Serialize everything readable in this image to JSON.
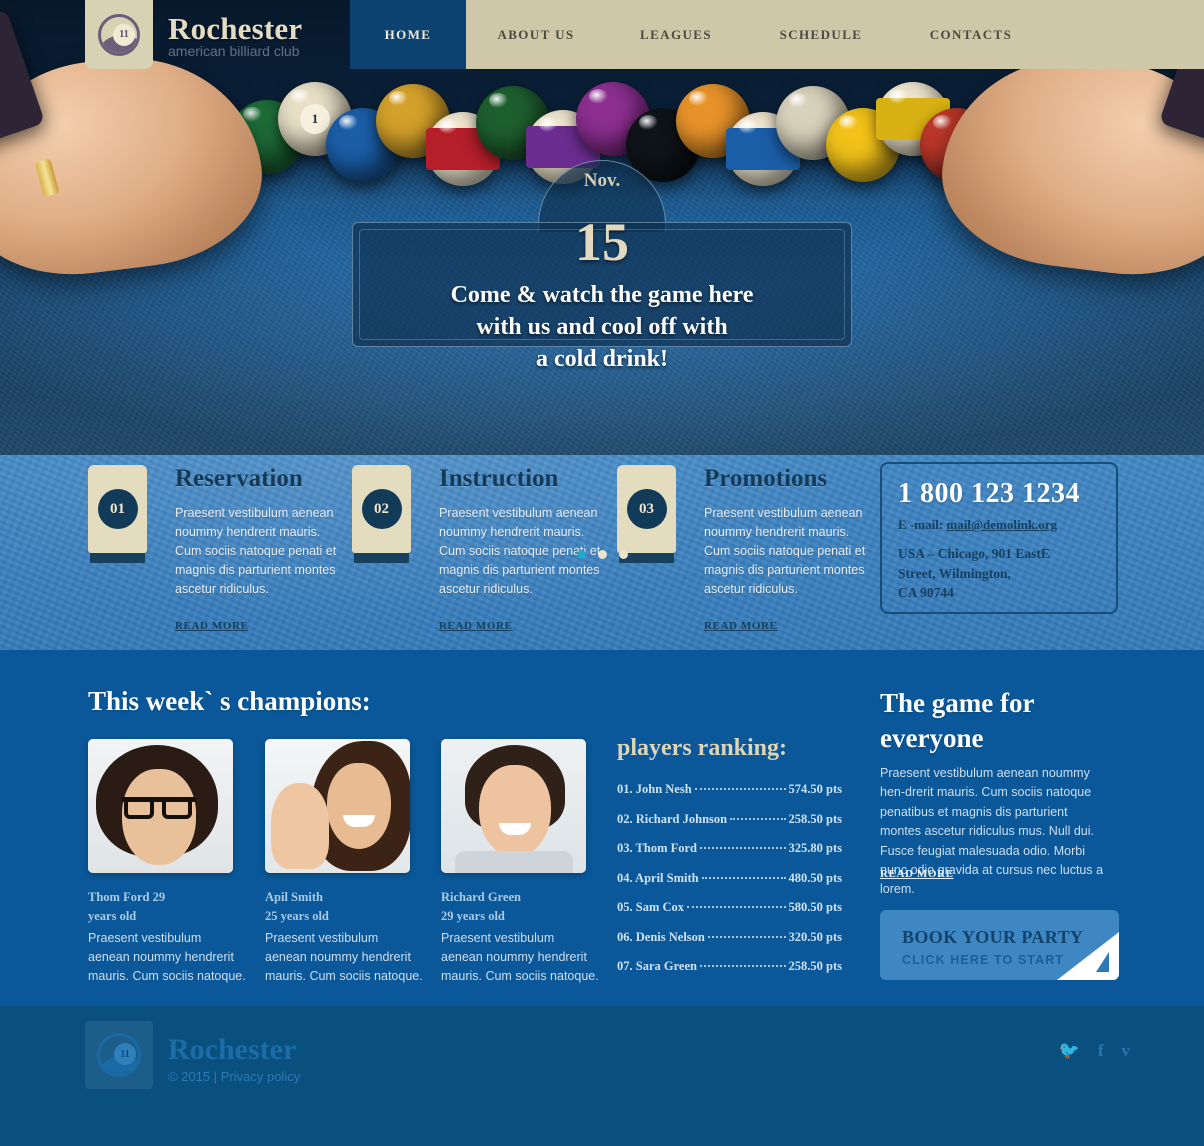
{
  "header": {
    "brand_name": "Rochester",
    "brand_tagline": "american billiard club",
    "logo_icon": "billiard-ball-icon",
    "logo_number": "11",
    "nav": [
      {
        "label": "HOME",
        "active": true
      },
      {
        "label": "ABOUT US",
        "active": false
      },
      {
        "label": "LEAGUES",
        "active": false
      },
      {
        "label": "SCHEDULE",
        "active": false
      },
      {
        "label": "CONTACTS",
        "active": false
      }
    ]
  },
  "hero": {
    "month": "Nov.",
    "day": "15",
    "line1": "Come & watch the game here",
    "line2": "with us and cool off with",
    "line3": "a cold drink!",
    "slider_dots": 3,
    "active_dot": 1,
    "active_dot_color": "#22a6c9",
    "inactive_dot_color": "#ece3c8"
  },
  "features": [
    {
      "number": "01",
      "title": "Reservation",
      "text": "Praesent vestibulum aenean noummy hendrerit mauris. Cum sociis natoque penati et magnis dis parturient montes ascetur ridiculus.",
      "read_more": "READ MORE"
    },
    {
      "number": "02",
      "title": "Instruction",
      "text": "Praesent vestibulum aenean noummy hendrerit mauris. Cum sociis natoque penati et magnis dis parturient montes ascetur ridiculus.",
      "read_more": "READ MORE"
    },
    {
      "number": "03",
      "title": "Promotions",
      "text": "Praesent vestibulum aenean noummy hendrerit mauris. Cum sociis natoque penati et magnis dis parturient montes ascetur ridiculus.",
      "read_more": "READ MORE"
    }
  ],
  "contact": {
    "phone": "1 800 123 1234",
    "email_label": "E -mail:",
    "email": "mail@demolink.org",
    "address_line1": "USA – Chicago, 901 EastE",
    "address_line2": "Street, Wilmington,",
    "address_line3": "CA 90744"
  },
  "champions": {
    "heading": "This week` s champions:",
    "people": [
      {
        "name_line1": "Thom Ford 29",
        "name_line2": "years old",
        "desc": "Praesent vestibulum aenean noummy hendrerit mauris. Cum sociis natoque."
      },
      {
        "name_line1": "Apil Smith",
        "name_line2": "25 years old",
        "desc": "Praesent vestibulum aenean noummy hendrerit mauris. Cum sociis natoque."
      },
      {
        "name_line1": "Richard Green",
        "name_line2": "29 years old",
        "desc": "Praesent vestibulum aenean noummy hendrerit mauris. Cum sociis natoque."
      }
    ]
  },
  "ranking": {
    "title": "players ranking:",
    "rows": [
      {
        "name": "01. John Nesh",
        "points": "574.50 pts"
      },
      {
        "name": "02. Richard Johnson",
        "points": "258.50 pts"
      },
      {
        "name": "03. Thom Ford",
        "points": "325.80 pts"
      },
      {
        "name": "04. April Smith",
        "points": "480.50 pts"
      },
      {
        "name": "05. Sam Cox",
        "points": "580.50 pts"
      },
      {
        "name": "06. Denis Nelson",
        "points": "320.50 pts"
      },
      {
        "name": "07. Sara Green",
        "points": "258.50 pts"
      }
    ]
  },
  "game_for_everyone": {
    "title_line1": "The game for",
    "title_line2": "everyone",
    "text": "Praesent vestibulum aenean noummy hen-drerit mauris. Cum sociis natoque penatibus et magnis dis parturient montes ascetur ridiculus mus. Null dui. Fusce feugiat malesuada odio. Morbi nunc odio gravida at cursus nec luctus a lorem.",
    "read_more": "READ MORE",
    "cta_title": "BOOK YOUR PARTY",
    "cta_sub": "CLICK HERE TO START"
  },
  "footer": {
    "brand_name": "Rochester",
    "logo_number": "11",
    "copyright": "© 2015  |",
    "privacy": "Privacy policy",
    "social": [
      {
        "name": "twitter-icon",
        "glyph": "🐦"
      },
      {
        "name": "facebook-icon",
        "glyph": "f"
      },
      {
        "name": "vimeo-icon",
        "glyph": "v"
      }
    ]
  },
  "colors": {
    "cream": "#d8d2b4",
    "nav_bar": "#cfc8a8",
    "nav_active": "#0b4270",
    "band_blue": "#0a5899",
    "footer_blue": "#09507f",
    "feature_blue": "#3a80bf",
    "accent_cyan": "#22a6c9"
  }
}
